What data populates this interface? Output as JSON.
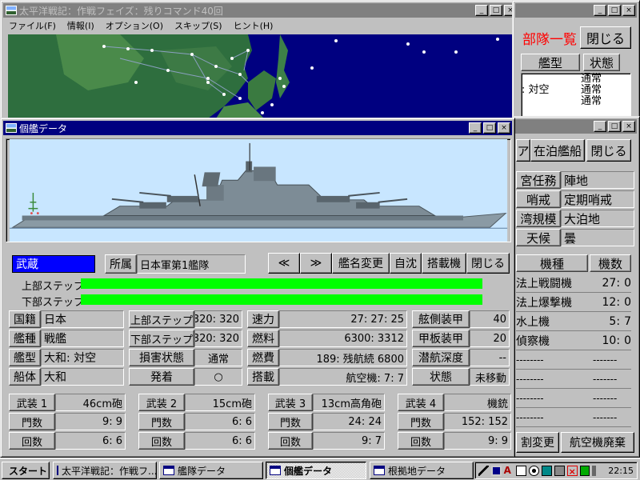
{
  "main_window": {
    "title": "太平洋戦記：作戦フェイズ：残りコマンド40回",
    "menu": [
      "ファイル(F)",
      "情報(I)",
      "オプション(O)",
      "スキップ(S)",
      "ヒント(H)"
    ]
  },
  "fleet_list_window": {
    "heading": "部隊一覧",
    "close_label": "閉じる",
    "col_type": "艦型",
    "col_status": "状態",
    "rows": [
      {
        "type": "",
        "status": "通常"
      },
      {
        "type": ": 対空",
        "status": "通常"
      },
      {
        "type": "",
        "status": "通常"
      }
    ]
  },
  "base_window": {
    "tab_prefix": "ア",
    "anchored_label": "在泊艦船",
    "close_label": "閉じる",
    "info": [
      {
        "label": "宮任務",
        "value": "陣地"
      },
      {
        "label": "哨戒",
        "value": "定期哨戒"
      },
      {
        "label": "湾規模",
        "value": "大泊地"
      },
      {
        "label": "天候",
        "value": "曇"
      }
    ],
    "aircraft_header": [
      "機種",
      "機数"
    ],
    "aircraft": [
      {
        "name": "法上戦闘機",
        "a": "27",
        "b": "0"
      },
      {
        "name": "法上爆撃機",
        "a": "12",
        "b": "0"
      },
      {
        "name": "水上機",
        "a": "5",
        "b": "7"
      },
      {
        "name": "偵察機",
        "a": "10",
        "b": "0"
      }
    ],
    "empty_row_a": "--------",
    "empty_row_b": "-------",
    "btn_change": "割変更",
    "btn_discard": "航空機廃棄"
  },
  "ship_window": {
    "title": "個艦データ",
    "name": "武蔵",
    "affiliation_label": "所属",
    "affiliation": "日本軍第1艦隊",
    "buttons": {
      "prev": "≪",
      "next": "≫",
      "rename": "艦名変更",
      "scuttle": "自沈",
      "aircraft": "搭載機",
      "close": "閉じる"
    },
    "step_upper_label": "上部ステップ",
    "step_lower_label": "下部ステップ",
    "step_upper_fraction": 1.0,
    "step_lower_fraction": 1.0,
    "col1": [
      {
        "label": "国籍",
        "value": "日本"
      },
      {
        "label": "艦種",
        "value": "戦艦"
      },
      {
        "label": "艦型",
        "value": "大和: 対空"
      },
      {
        "label": "船体",
        "value": "大和"
      }
    ],
    "col2": [
      {
        "label": "上部ステップ",
        "value": "320: 320"
      },
      {
        "label": "下部ステップ",
        "value": "320: 320"
      },
      {
        "label": "損害状態",
        "value": "通常"
      },
      {
        "label": "発着",
        "value": "○"
      }
    ],
    "col3": [
      {
        "label": "速力",
        "value": "27: 27: 25"
      },
      {
        "label": "燃料",
        "value": "6300:  3312"
      },
      {
        "label": "燃費",
        "value": "189: 残航続  6800"
      },
      {
        "label": "搭載",
        "value": "航空機: 7: 7"
      }
    ],
    "col4": [
      {
        "label": "舷側装甲",
        "value": "40"
      },
      {
        "label": "甲板装甲",
        "value": "20"
      },
      {
        "label": "潜航深度",
        "value": "--"
      },
      {
        "label": "状態",
        "value": "未移動"
      }
    ],
    "armaments": [
      {
        "label": "武装 1",
        "weapon": "46cm砲",
        "mounts_label": "門数",
        "mounts": "9:   9",
        "rounds_label": "回数",
        "rounds": "6: 6"
      },
      {
        "label": "武装 2",
        "weapon": "15cm砲",
        "mounts_label": "門数",
        "mounts": "6:   6",
        "rounds_label": "回数",
        "rounds": "6: 6"
      },
      {
        "label": "武装 3",
        "weapon": "13cm高角砲",
        "mounts_label": "門数",
        "mounts": "24:  24",
        "rounds_label": "回数",
        "rounds": "9: 7"
      },
      {
        "label": "武装 4",
        "weapon": "機銃",
        "mounts_label": "門数",
        "mounts": "152: 152",
        "rounds_label": "回数",
        "rounds": "9: 9"
      }
    ]
  },
  "taskbar": {
    "start": "スタート",
    "items": [
      "太平洋戦記：作戦フ...",
      "艦隊データ",
      "個艦データ",
      "根拠地データ"
    ],
    "active_index": 2,
    "clock": "22:15"
  },
  "colors": {
    "title_active": "#000080",
    "step_bar": "#00ff00",
    "name_highlight": "#0000ff",
    "red_heading": "#ff0000"
  }
}
